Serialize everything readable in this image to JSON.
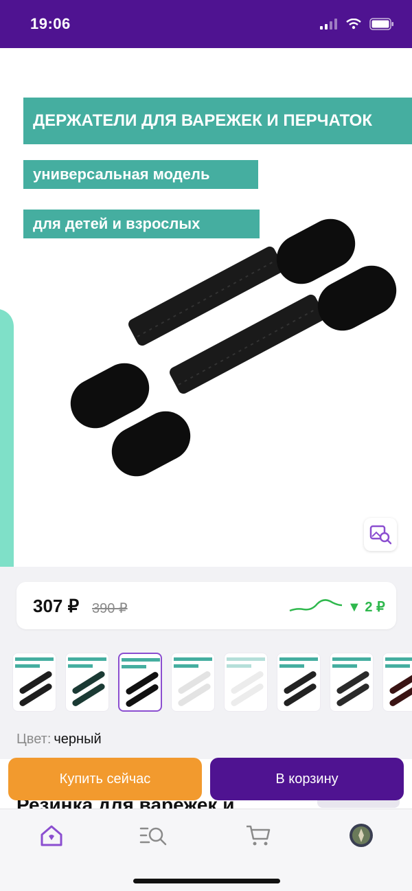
{
  "status_bar": {
    "time": "19:06"
  },
  "gallery": {
    "banner_title": "ДЕРЖАТЕЛИ ДЛЯ ВАРЕЖЕК И ПЕРЧАТОК",
    "banner_sub1": "универсальная модель",
    "banner_sub2": "для детей и взрослых"
  },
  "price": {
    "current": "307 ₽",
    "old": "390 ₽",
    "drop": "▼ 2 ₽"
  },
  "thumbnails": {
    "count": 8,
    "selected_index": 2
  },
  "color": {
    "label": "Цвет:",
    "value": "черный"
  },
  "actions": {
    "buy_now": "Купить сейчас",
    "to_cart": "В корзину"
  },
  "product": {
    "title_partial": "Резинка для варежек и"
  },
  "nav": {
    "items": [
      "home-icon",
      "catalog-search-icon",
      "cart-icon",
      "profile-avatar"
    ]
  },
  "colors": {
    "brand": "#4f1391",
    "accent_orange": "#f29a2e",
    "teal": "#45aea0",
    "price_drop": "#2fb84d"
  }
}
